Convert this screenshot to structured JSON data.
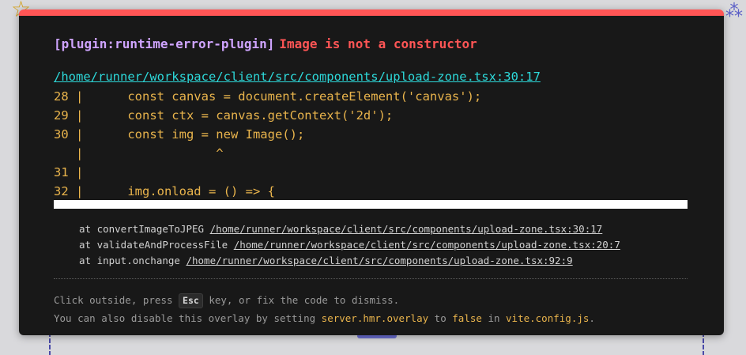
{
  "error": {
    "plugin": "[plugin:runtime-error-plugin]",
    "message": "Image is not a constructor",
    "file": "/home/runner/workspace/client/src/components/upload-zone.tsx:30:17"
  },
  "frame": [
    "28 |      const canvas = document.createElement('canvas');",
    "29 |      const ctx = canvas.getContext('2d');",
    "30 |      const img = new Image();",
    "   |                  ^",
    "31 |",
    "32 |      img.onload = () => {"
  ],
  "stack": [
    {
      "prefix": "at convertImageToJPEG",
      "link": "/home/runner/workspace/client/src/components/upload-zone.tsx:30:17"
    },
    {
      "prefix": "at validateAndProcessFile",
      "link": "/home/runner/workspace/client/src/components/upload-zone.tsx:20:7"
    },
    {
      "prefix": "at input.onchange",
      "link": "/home/runner/workspace/client/src/components/upload-zone.tsx:92:9"
    }
  ],
  "tip": {
    "line1_a": "Click outside, press",
    "key": "Esc",
    "line1_b": "key, or fix the code to dismiss.",
    "line2_a": "You can also disable this overlay by setting",
    "setting": "server.hmr.overlay",
    "line2_b": "to",
    "value": "false",
    "line2_c": "in",
    "config": "vite.config.js",
    "line2_d": "."
  },
  "colors": {
    "overlay_bg": "#181818",
    "accent_red": "#ff5555",
    "plugin_purple": "#cfa4ff",
    "link_cyan": "#2dd9da",
    "code_yellow": "#e9b44c"
  }
}
